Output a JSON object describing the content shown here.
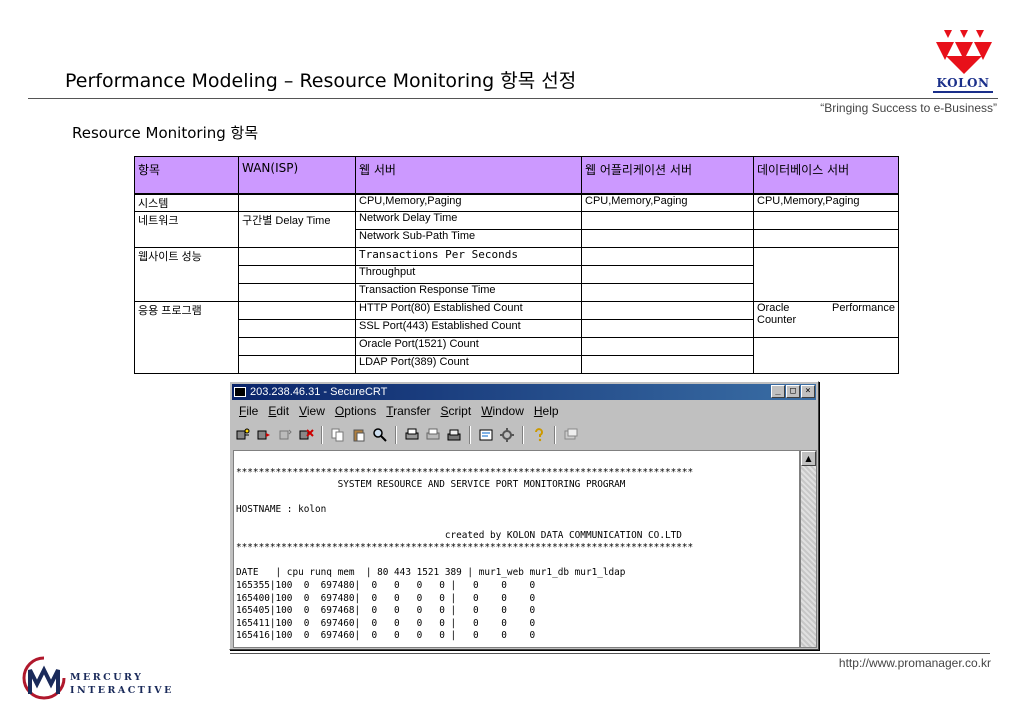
{
  "header": {
    "title": "Performance Modeling – Resource Monitoring 항목 선정",
    "logo_text": "KOLON",
    "slogan": "“Bringing Success to e-Business”",
    "subtitle": "Resource Monitoring 항목",
    "logo_color": "#e8101a"
  },
  "table": {
    "headers": [
      "항목",
      "WAN(ISP)",
      "웹 서버",
      "웹 어플리케이션 서버",
      "데이터베이스 서버"
    ],
    "header_bg": "#cc99ff",
    "cells": {
      "system": "시스템",
      "system_web": "CPU,Memory,Paging",
      "system_was": "CPU,Memory,Paging",
      "system_db": "CPU,Memory,Paging",
      "network": "네트워크",
      "network_wan": "구간별 Delay Time",
      "network_web_1": "Network Delay Time",
      "network_web_2": "Network Sub-Path Time",
      "website": "웹사이트 성능",
      "website_web_1": "Transactions Per Seconds",
      "website_web_2": "Throughput",
      "website_web_3": "Transaction Response Time",
      "app": "응용 프로그램",
      "app_web_1": "HTTP Port(80) Established  Count",
      "app_web_2": "SSL Port(443) Established Count",
      "app_web_3": "Oracle Port(1521) Count",
      "app_web_4": "LDAP Port(389) Count",
      "app_db_1": "Oracle",
      "app_db_2": "Performance",
      "app_db_3": "Counter"
    }
  },
  "window": {
    "title": "203.238.46.31 - SecureCRT",
    "controls": [
      "_",
      "□",
      "×"
    ],
    "menu": [
      "File",
      "Edit",
      "View",
      "Options",
      "Transfer",
      "Script",
      "Window",
      "Help"
    ],
    "terminal_lines": [
      "",
      "*********************************************************************************",
      "                  SYSTEM RESOURCE AND SERVICE PORT MONITORING PROGRAM",
      "",
      "HOSTNAME : kolon",
      "",
      "                                     created by KOLON DATA COMMUNICATION CO.LTD",
      "*********************************************************************************",
      "",
      "DATE   | cpu runq mem  | 80 443 1521 389 | mur1_web mur1_db mur1_ldap",
      "165355|100  0  697480|  0   0   0   0 |   0    0    0",
      "165400|100  0  697480|  0   0   0   0 |   0    0    0",
      "165405|100  0  697468|  0   0   0   0 |   0    0    0",
      "165411|100  0  697460|  0   0   0   0 |   0    0    0",
      "165416|100  0  697460|  0   0   0   0 |   0    0    0"
    ]
  },
  "footer": {
    "url": "http://www.promanager.co.kr",
    "mi_line1": "MERCURY",
    "mi_line2": "INTERACTIVE"
  }
}
